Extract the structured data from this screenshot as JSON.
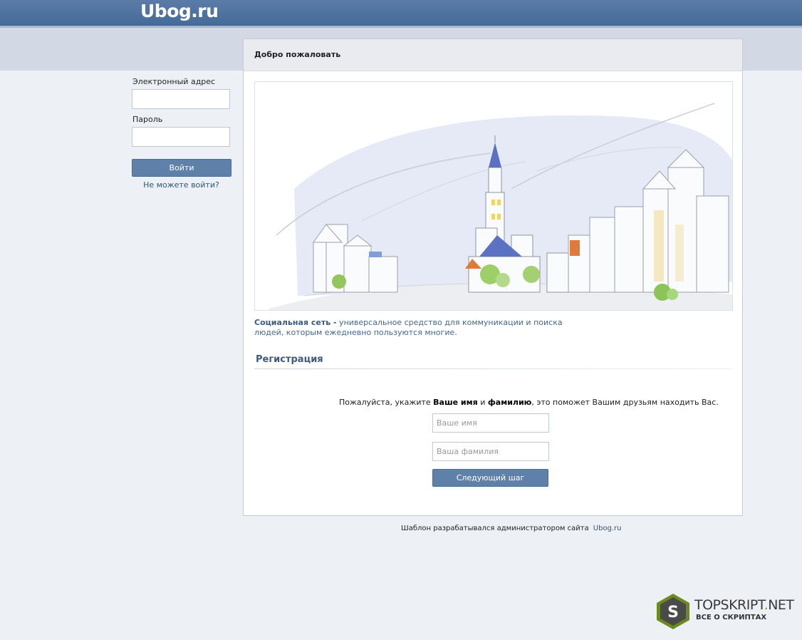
{
  "header": {
    "logo": "Ubog.ru"
  },
  "login": {
    "email_label": "Электронный адрес",
    "email_value": "",
    "password_label": "Пароль",
    "password_value": "",
    "submit_label": "Войти",
    "forgot_link": "Не можете войти?"
  },
  "welcome": {
    "title": "Добро пожаловать",
    "desc_bold": "Социальная сеть -",
    "desc_rest": " универсальное средство для коммуникации и поиска людей, которым ежедневно пользуются многие."
  },
  "registration": {
    "title": "Регистрация",
    "prompt_pre": "Пожалуйста, укажите ",
    "prompt_b1": "Ваше имя",
    "prompt_mid": " и ",
    "prompt_b2": "фамилию",
    "prompt_post": ", это поможет Вашим друзьям находить Вас.",
    "first_name_placeholder": "Ваше имя",
    "last_name_placeholder": "Ваша фамилия",
    "next_label": "Следующий шаг"
  },
  "footer": {
    "text": "Шаблон разрабатывался администратором сайта",
    "link": "Ubog.ru"
  },
  "watermark": {
    "letter": "S",
    "brand_a": "TOPSKRIPT",
    "brand_dot": ".",
    "brand_b": "NET",
    "tagline": "ВСЕ О СКРИПТАХ"
  },
  "colors": {
    "header": "#4e73a0",
    "button": "#5f80a9",
    "link": "#2b587a",
    "background": "#edf1f5"
  }
}
